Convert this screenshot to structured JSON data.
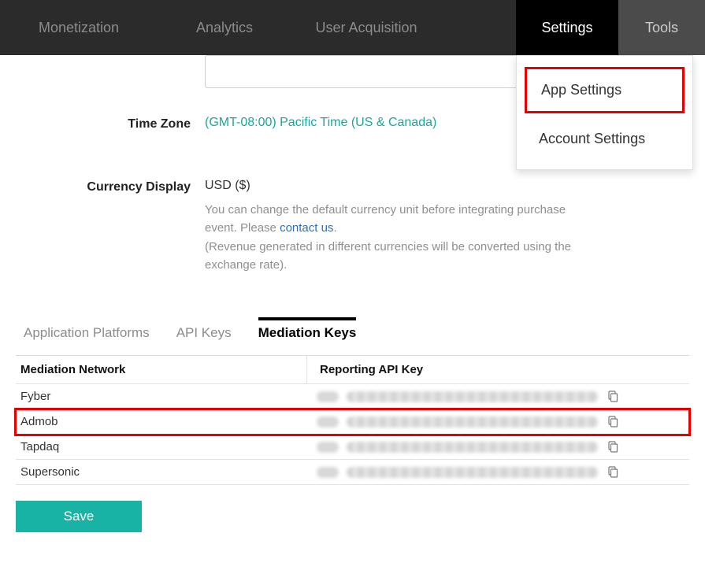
{
  "nav": {
    "monetization": "Monetization",
    "analytics": "Analytics",
    "acquisition": "User Acquisition",
    "settings": "Settings",
    "tools": "Tools"
  },
  "dropdown": {
    "app_settings": "App Settings",
    "account_settings": "Account Settings"
  },
  "timezone": {
    "label": "Time Zone",
    "value": "(GMT-08:00) Pacific Time (US & Canada)"
  },
  "currency": {
    "label": "Currency Display",
    "value": "USD ($)",
    "help_a": "You can change the default currency unit before integrating purchase event. Please ",
    "contact": "contact us",
    "help_a_end": ".",
    "help_b": "(Revenue generated in different currencies will be converted using the exchange rate)."
  },
  "subtabs": {
    "platforms": "Application Platforms",
    "api_keys": "API Keys",
    "mediation_keys": "Mediation Keys"
  },
  "table": {
    "col_network": "Mediation Network",
    "col_apikey": "Reporting API Key",
    "rows": [
      {
        "network": "Fyber"
      },
      {
        "network": "Admob"
      },
      {
        "network": "Tapdaq"
      },
      {
        "network": "Supersonic"
      }
    ]
  },
  "save_label": "Save"
}
